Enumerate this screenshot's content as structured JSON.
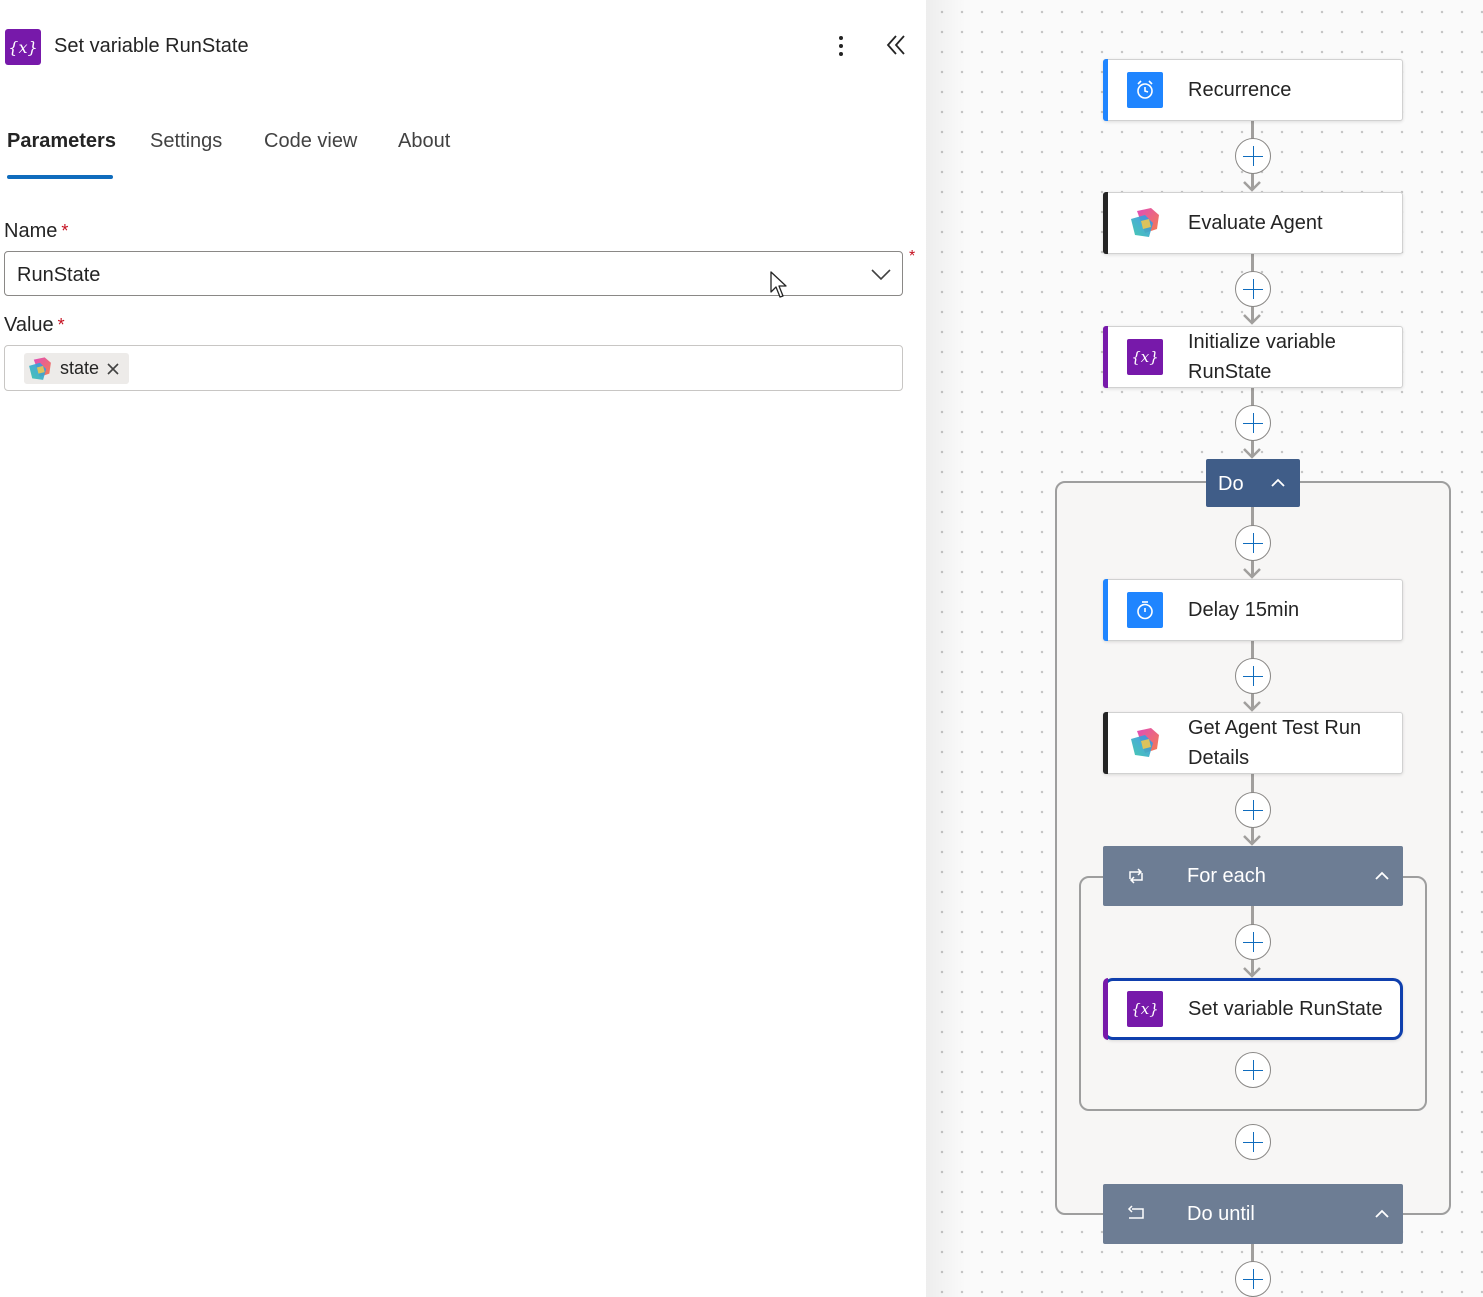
{
  "panel": {
    "title": "Set variable RunState",
    "icon": "variable-icon",
    "tabs": [
      {
        "label": "Parameters",
        "active": true
      },
      {
        "label": "Settings",
        "active": false
      },
      {
        "label": "Code view",
        "active": false
      },
      {
        "label": "About",
        "active": false
      }
    ],
    "fields": {
      "name": {
        "label": "Name",
        "required_mark": "*",
        "value": "RunState"
      },
      "value": {
        "label": "Value",
        "required_mark": "*",
        "token": {
          "label": "state",
          "icon": "copilot-agent-icon"
        }
      }
    },
    "outside_required_mark": "*"
  },
  "flow": {
    "nodes": [
      {
        "id": "recurrence",
        "title": "Recurrence",
        "icon": "alarm-clock-icon",
        "accent": "#1f85ff"
      },
      {
        "id": "evaluate-agent",
        "title": "Evaluate Agent",
        "icon": "copilot-agent-icon",
        "accent": "#242424"
      },
      {
        "id": "initialize-variable",
        "title": "Initialize variable RunState",
        "icon": "variable-icon",
        "accent": "#7719aa"
      },
      {
        "id": "delay",
        "title": "Delay 15min",
        "icon": "timer-icon",
        "accent": "#1f85ff"
      },
      {
        "id": "get-agent-test-run",
        "title": "Get Agent Test Run Details",
        "icon": "copilot-agent-icon",
        "accent": "#242424"
      },
      {
        "id": "set-variable",
        "title": "Set variable RunState",
        "icon": "variable-icon",
        "accent": "#7719aa",
        "selected": true
      }
    ],
    "scopes": {
      "do": {
        "title": "Do"
      },
      "for_each": {
        "title": "For each",
        "icon": "loop-icon"
      },
      "do_until": {
        "title": "Do until",
        "icon": "do-until-icon"
      }
    }
  },
  "colors": {
    "variable": "#7719aa",
    "schedule": "#1f85ff",
    "scope_header": "#6d7d94",
    "do_header": "#405d88",
    "selected_border": "#0f3fad",
    "active_tab": "#0f6cbd"
  }
}
